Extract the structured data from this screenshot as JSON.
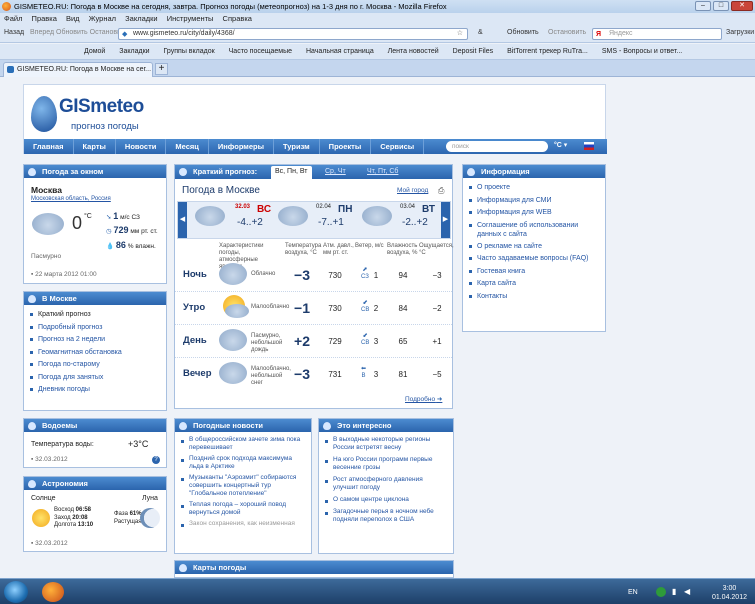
{
  "browser": {
    "title": "GISMETEO.RU: Погода в Москве на сегодня, завтра. Прогноз погоды (метеопрогноз) на 1-3 дня по г. Москва - Mozilla Firefox",
    "menu": [
      "Файл",
      "Правка",
      "Вид",
      "Журнал",
      "Закладки",
      "Инструменты",
      "Справка"
    ],
    "nav_back": "Назад",
    "nav_extra": "Вперед  Обновить  Остановить",
    "url": "www.gismeteo.ru/city/daily/4368/",
    "right_nav": [
      "Обновить",
      "Остановить"
    ],
    "search_placeholder": "Яндекс",
    "downloads": "Загрузки",
    "bookmarks": [
      "Домой",
      "Закладки",
      "Группы вкладок",
      "Часто посещаемые",
      "Начальная страница",
      "Лента новостей",
      "Deposit Files",
      "BitTorrent трекер RuTra...",
      "SMS - Вопросы и ответ..."
    ],
    "tab_title": "GISMETEO.RU: Погода в Москве на сег...",
    "new_tab": "+"
  },
  "site": {
    "logo_text": "GISmeteo",
    "logo_sub": "прогноз погоды",
    "nav": [
      "Главная",
      "Карты",
      "Новости",
      "Месяц",
      "Информеры",
      "Туризм",
      "Проекты",
      "Сервисы"
    ],
    "search_placeholder": "поиск",
    "unit": "°C ▾"
  },
  "window_weather": {
    "title": "Погода за окном",
    "city": "Москва",
    "region": "Московская область, Россия",
    "temp": "0",
    "temp_unit": "°C",
    "wind": "1",
    "wind_unit": "м/с",
    "wind_dir": "СЗ",
    "pressure": "729",
    "pressure_unit": "мм рт. ст.",
    "humidity": "86",
    "humidity_unit": "% влажн.",
    "condition": "Пасмурно",
    "updated": "22 марта 2012 01:00"
  },
  "in_moscow": {
    "title": "В Москве",
    "items": [
      "Краткий прогноз",
      "Подробный прогноз",
      "Прогноз на 2 недели",
      "Геомагнитная обстановка",
      "Погода по-старому",
      "Погода для занятых",
      "Дневник погоды"
    ]
  },
  "water": {
    "title": "Водоемы",
    "label": "Температура воды:",
    "value": "+3°C",
    "date": "32.03.2012"
  },
  "astronomy": {
    "title": "Астрономия",
    "sun_label": "Солнце",
    "moon_label": "Луна",
    "sunrise_label": "Восход",
    "sunrise": "06:58",
    "sunset_label": "Заход",
    "sunset": "20:08",
    "daylength_label": "Долгота",
    "daylength": "13:10",
    "moon_phase_label": "Фаза",
    "moon_phase": "61%",
    "moon_state": "Растущая",
    "date": "32.03.2012"
  },
  "forecast": {
    "tab_label": "Краткий прогноз:",
    "tabs": [
      "Вс, Пн, Вт",
      "Ср, Чт",
      "Чт, Пт, Сб"
    ],
    "title": "Погода в Москве",
    "my_city": "Мой город",
    "days": [
      {
        "date": "32.03",
        "day": "ВС",
        "temps": "-4..+2"
      },
      {
        "date": "02.04",
        "day": "ПН",
        "temps": "-7..+1"
      },
      {
        "date": "03.04",
        "day": "ВТ",
        "temps": "-2..+2"
      }
    ],
    "col_headers": [
      "Характеристики погоды, атмосферные явления",
      "Температура воздуха, °C",
      "Атм. давл., мм рт. ст.",
      "Ветер, м/с",
      "Влажность воздуха, %",
      "Ощущается, °C"
    ],
    "rows": [
      {
        "label": "Ночь",
        "cond": "Облачно",
        "temp": "−3",
        "press": "730",
        "wind_dir": "СЗ",
        "wind": "1",
        "hum": "94",
        "feel": "−3"
      },
      {
        "label": "Утро",
        "cond": "Малооблачно",
        "temp": "−1",
        "press": "730",
        "wind_dir": "СВ",
        "wind": "2",
        "hum": "84",
        "feel": "−2"
      },
      {
        "label": "День",
        "cond": "Пасмурно, небольшой дождь",
        "temp": "+2",
        "press": "729",
        "wind_dir": "СВ",
        "wind": "3",
        "hum": "65",
        "feel": "+1"
      },
      {
        "label": "Вечер",
        "cond": "Малооблачно, небольшой снег",
        "temp": "−3",
        "press": "731",
        "wind_dir": "В",
        "wind": "3",
        "hum": "81",
        "feel": "−5"
      }
    ],
    "more": "Подробно"
  },
  "info": {
    "title": "Информация",
    "items": [
      "О проекте",
      "Информация для СМИ",
      "Информация для WEB",
      "Соглашение об использовании данных с сайта",
      "О рекламе на сайте",
      "Часто задаваемые вопросы (FAQ)",
      "Гостевая книга",
      "Карта сайта",
      "Контакты"
    ]
  },
  "news": {
    "title": "Погодные новости",
    "items": [
      "В общероссийском зачете зима пока перевешивает",
      "Поздний срок подхода максимума льда в Арктике",
      "Музыканты \"Аэрозмит\" собираются совершить концертный тур \"Глобальное потепление\"",
      "Теплая погода – хороший повод вернуться домой",
      "Закон сохранения, как неизменная"
    ]
  },
  "interesting": {
    "title": "Это интересно",
    "items": [
      "В выходные некоторые регионы России встретят весну",
      "На юго России программ первые весенние грозы",
      "Рост атмосферного давления улучшит погоду",
      "О самом центре циклона",
      "Загадочные перья в ночном небе подняли переполох в США"
    ]
  },
  "maps": {
    "title": "Карты погоды"
  },
  "taskbar": {
    "lang": "EN",
    "time": "3:00",
    "date": "01.04.2012"
  },
  "colors": {
    "brand": "#2b64ad",
    "accent_red": "#cc0000",
    "link": "#2455a4"
  }
}
